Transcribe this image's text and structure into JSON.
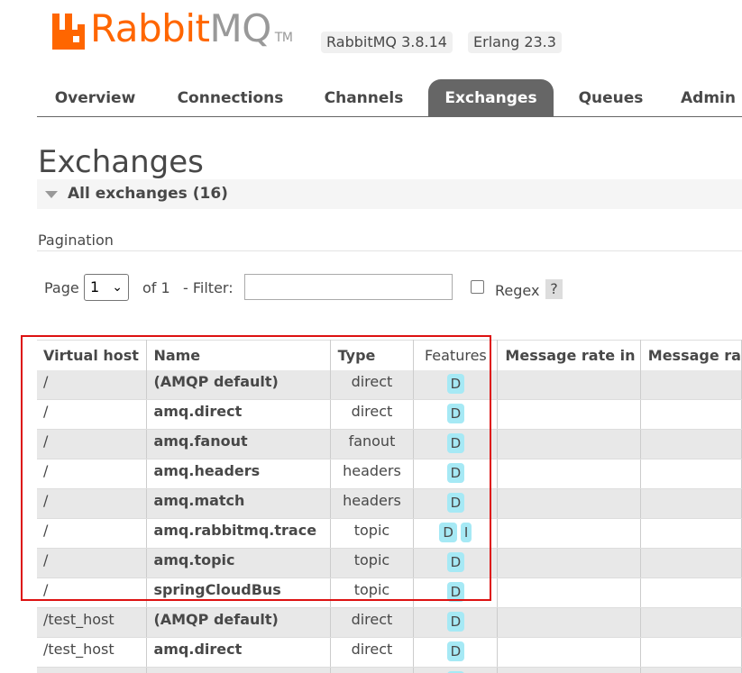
{
  "header": {
    "logo_word_orange": "Rabbit",
    "logo_word_grey": "MQ",
    "logo_tm": "TM",
    "version_rabbitmq": "RabbitMQ 3.8.14",
    "version_erlang": "Erlang 23.3"
  },
  "tabs": [
    {
      "label": "Overview",
      "active": false
    },
    {
      "label": "Connections",
      "active": false
    },
    {
      "label": "Channels",
      "active": false
    },
    {
      "label": "Exchanges",
      "active": true
    },
    {
      "label": "Queues",
      "active": false
    },
    {
      "label": "Admin",
      "active": false
    }
  ],
  "page_title": "Exchanges",
  "section_title": "All exchanges (16)",
  "pagination": {
    "label": "Pagination",
    "page_label": "Page",
    "page_value": "1",
    "of_label": "of 1",
    "filter_label": "- Filter:",
    "filter_value": "",
    "regex_label": "Regex",
    "regex_checked": false,
    "help_label": "?"
  },
  "table": {
    "headers": [
      "Virtual host",
      "Name",
      "Type",
      "Features",
      "Message rate in",
      "Message ra"
    ],
    "rows": [
      {
        "vhost": "/",
        "name": "(AMQP default)",
        "type": "direct",
        "features": [
          "D"
        ]
      },
      {
        "vhost": "/",
        "name": "amq.direct",
        "type": "direct",
        "features": [
          "D"
        ]
      },
      {
        "vhost": "/",
        "name": "amq.fanout",
        "type": "fanout",
        "features": [
          "D"
        ]
      },
      {
        "vhost": "/",
        "name": "amq.headers",
        "type": "headers",
        "features": [
          "D"
        ]
      },
      {
        "vhost": "/",
        "name": "amq.match",
        "type": "headers",
        "features": [
          "D"
        ]
      },
      {
        "vhost": "/",
        "name": "amq.rabbitmq.trace",
        "type": "topic",
        "features": [
          "D",
          "I"
        ]
      },
      {
        "vhost": "/",
        "name": "amq.topic",
        "type": "topic",
        "features": [
          "D"
        ]
      },
      {
        "vhost": "/",
        "name": "springCloudBus",
        "type": "topic",
        "features": [
          "D"
        ]
      },
      {
        "vhost": "/test_host",
        "name": "(AMQP default)",
        "type": "direct",
        "features": [
          "D"
        ]
      },
      {
        "vhost": "/test_host",
        "name": "amq.direct",
        "type": "direct",
        "features": [
          "D"
        ]
      },
      {
        "vhost": "",
        "name": "",
        "type": "",
        "features": [
          "D"
        ]
      }
    ]
  },
  "colors": {
    "logo_orange": "#ff6600",
    "tab_active_bg": "#666666",
    "feature_badge": "#a6e9f5",
    "highlight_border": "#dd1111",
    "row_alt": "#e8e8e8"
  }
}
